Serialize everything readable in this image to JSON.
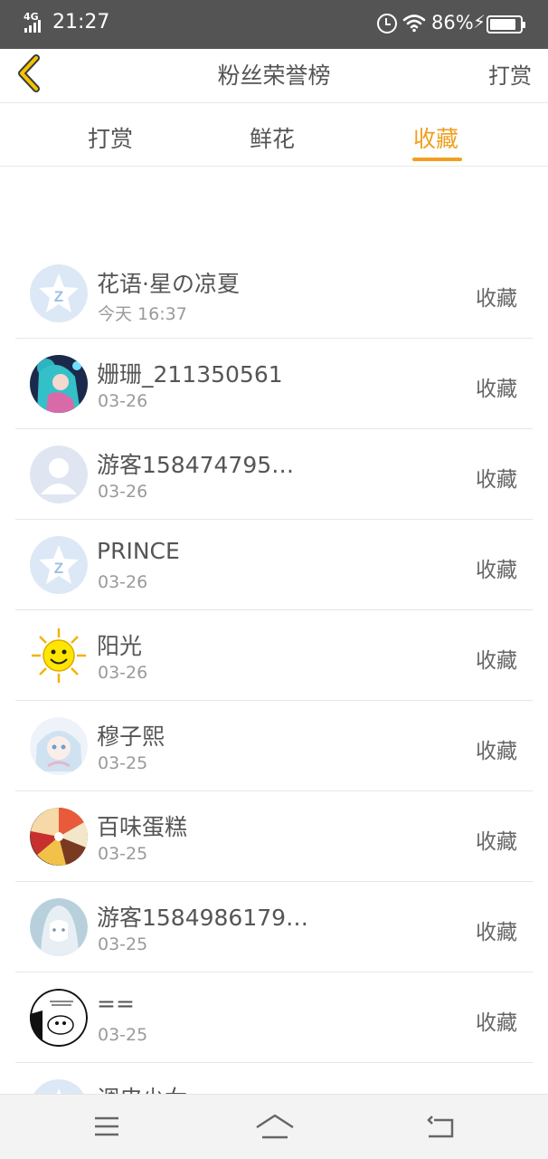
{
  "status_bar": {
    "network": "4G",
    "time": "21:27",
    "battery_percent": "86%",
    "battery_level": 0.86,
    "icons": [
      "signal-icon",
      "alarm-icon",
      "wifi-icon",
      "charging-icon",
      "battery-icon"
    ]
  },
  "header": {
    "title": "粉丝荣誉榜",
    "action": "打赏",
    "back_icon": "chevron-left-icon",
    "accent_color": "#f0a020"
  },
  "tabs": [
    {
      "label": "打赏",
      "active": false
    },
    {
      "label": "鲜花",
      "active": false
    },
    {
      "label": "收藏",
      "active": true
    }
  ],
  "list": [
    {
      "name": "花语·星の凉夏",
      "date": "今天 16:37",
      "action": "收藏",
      "avatar": "default-star-avatar"
    },
    {
      "name": "姗珊_211350561",
      "date": "03-26",
      "action": "收藏",
      "avatar": "anime-girl-avatar"
    },
    {
      "name": "游客158474795…",
      "date": "03-26",
      "action": "收藏",
      "avatar": "default-person-avatar"
    },
    {
      "name": "PRINCE",
      "date": "03-26",
      "action": "收藏",
      "avatar": "default-star-avatar"
    },
    {
      "name": "阳光",
      "date": "03-26",
      "action": "收藏",
      "avatar": "sun-avatar"
    },
    {
      "name": "穆子熙",
      "date": "03-25",
      "action": "收藏",
      "avatar": "anime-girl-avatar"
    },
    {
      "name": "百味蛋糕",
      "date": "03-25",
      "action": "收藏",
      "avatar": "cake-avatar"
    },
    {
      "name": "游客1584986179…",
      "date": "03-25",
      "action": "收藏",
      "avatar": "sketch-girl-avatar"
    },
    {
      "name": "==",
      "date": "03-25",
      "action": "收藏",
      "avatar": "comic-avatar"
    },
    {
      "name": "调皮少女",
      "date": "",
      "action": "",
      "avatar": "default-star-avatar"
    }
  ],
  "nav_bar": {
    "icons": [
      "menu-icon",
      "home-icon",
      "back-icon"
    ]
  }
}
